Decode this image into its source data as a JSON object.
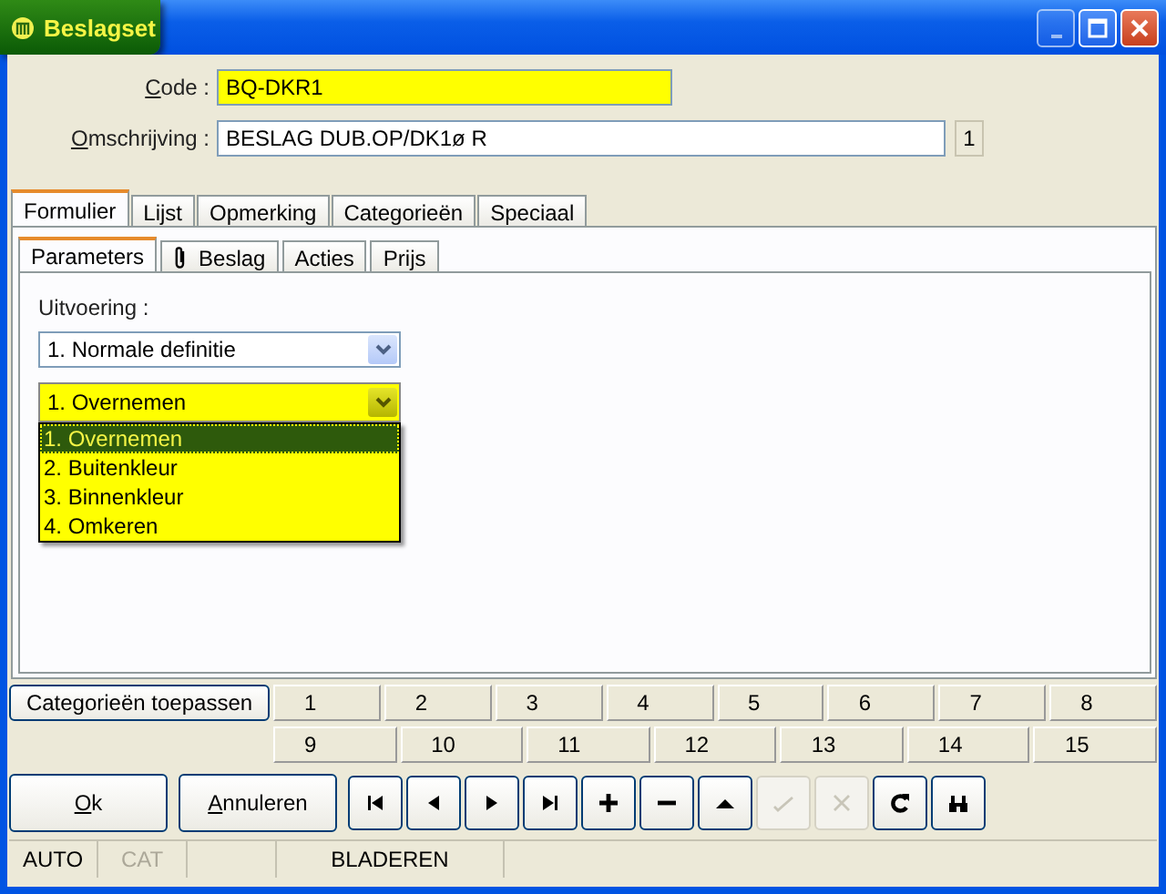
{
  "window": {
    "title": "Beslagset",
    "controls": [
      {
        "kind": "minimize",
        "disabled": true
      },
      {
        "kind": "maximize",
        "disabled": false
      },
      {
        "kind": "close",
        "disabled": false
      }
    ]
  },
  "code": {
    "label": "Code :",
    "underline_first": true,
    "value": "BQ-DKR1",
    "highlighted": true
  },
  "omschrijving": {
    "label": "Omschrijving :",
    "underline_first": true,
    "value": "BESLAG DUB.OP/DK1ø R",
    "highlighted": false,
    "counter": "1"
  },
  "tabs": [
    {
      "label": "Formulier",
      "selected": true
    },
    {
      "label": "Lijst",
      "selected": false
    },
    {
      "label": "Opmerking",
      "selected": false
    },
    {
      "label": "Categorieën",
      "selected": false
    },
    {
      "label": "Speciaal",
      "selected": false
    }
  ],
  "subtabs": [
    {
      "label": "Parameters",
      "selected": true,
      "kind": "text"
    },
    {
      "label": "Beslag",
      "selected": false,
      "kind": "paperclip"
    },
    {
      "label": "Acties",
      "selected": false,
      "kind": "text"
    },
    {
      "label": "Prijs",
      "selected": false,
      "kind": "text"
    }
  ],
  "uitvoering": {
    "label": "Uitvoering :",
    "value": "1.  Normale definitie",
    "highlighted": false
  },
  "overnemen": {
    "value": "1.  Overnemen",
    "highlighted": true,
    "expanded": true,
    "options": [
      {
        "label": "1.  Overnemen",
        "selected": true
      },
      {
        "label": "2.  Buitenkleur",
        "selected": false
      },
      {
        "label": "3.  Binnenkleur",
        "selected": false
      },
      {
        "label": "4.  Omkeren",
        "selected": false
      }
    ]
  },
  "category_button": "Categorieën toepassen",
  "category_rows": [
    [
      "1",
      "2",
      "3",
      "4",
      "5",
      "6",
      "7",
      "8"
    ],
    [
      "9",
      "10",
      "11",
      "12",
      "13",
      "14",
      "15"
    ]
  ],
  "buttons": [
    {
      "label": "Ok",
      "underline_first": true
    },
    {
      "label": "Annuleren",
      "underline_first": true
    }
  ],
  "toolbar": [
    {
      "kind": "first",
      "disabled": false
    },
    {
      "kind": "previous",
      "disabled": false
    },
    {
      "kind": "next",
      "disabled": false
    },
    {
      "kind": "last",
      "disabled": false
    },
    {
      "kind": "add",
      "disabled": false
    },
    {
      "kind": "remove",
      "disabled": false
    },
    {
      "kind": "up",
      "disabled": false
    },
    {
      "kind": "confirm",
      "disabled": true
    },
    {
      "kind": "cancel",
      "disabled": true
    },
    {
      "kind": "refresh",
      "disabled": false
    },
    {
      "kind": "find",
      "disabled": false
    }
  ],
  "status_bar": [
    {
      "text": "AUTO",
      "disabled": false
    },
    {
      "text": "CAT",
      "disabled": true
    },
    {
      "text": "BLADEREN",
      "disabled": false
    }
  ]
}
